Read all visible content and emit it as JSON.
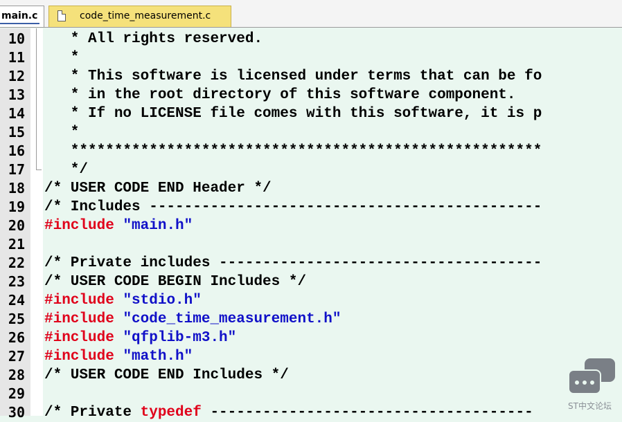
{
  "tabs": [
    {
      "label": "main.c"
    },
    {
      "label": "code_time_measurement.c"
    }
  ],
  "colors": {
    "keyword": "#e0001a",
    "string": "#1010c8",
    "editor_bg": "#eaf7f0"
  },
  "lines": [
    {
      "num": "10",
      "text": "   * All rights reserved."
    },
    {
      "num": "11",
      "text": "   *"
    },
    {
      "num": "12",
      "text": "   * This software is licensed under terms that can be fo"
    },
    {
      "num": "13",
      "text": "   * in the root directory of this software component."
    },
    {
      "num": "14",
      "text": "   * If no LICENSE file comes with this software, it is p"
    },
    {
      "num": "15",
      "text": "   *"
    },
    {
      "num": "16",
      "text": "   ******************************************************"
    },
    {
      "num": "17",
      "text": "   */"
    },
    {
      "num": "18",
      "text": "/* USER CODE END Header */"
    },
    {
      "num": "19",
      "text": "/* Includes ---------------------------------------------"
    },
    {
      "num": "20",
      "kw": "#include",
      "str": "\"main.h\""
    },
    {
      "num": "21",
      "text": ""
    },
    {
      "num": "22",
      "text": "/* Private includes -------------------------------------"
    },
    {
      "num": "23",
      "text": "/* USER CODE BEGIN Includes */"
    },
    {
      "num": "24",
      "kw": "#include",
      "str": "\"stdio.h\""
    },
    {
      "num": "25",
      "kw": "#include",
      "str": "\"code_time_measurement.h\""
    },
    {
      "num": "26",
      "kw": "#include",
      "str": "\"qfplib-m3.h\""
    },
    {
      "num": "27",
      "kw": "#include",
      "str": "\"math.h\""
    },
    {
      "num": "28",
      "text": "/* USER CODE END Includes */"
    },
    {
      "num": "29",
      "text": ""
    },
    {
      "num": "30",
      "pre": "/* Private ",
      "kw": "typedef",
      "post": " -------------------------------------"
    }
  ],
  "watermark": {
    "text": "ST中文论坛",
    "icon": "chat-bubbles-icon"
  }
}
